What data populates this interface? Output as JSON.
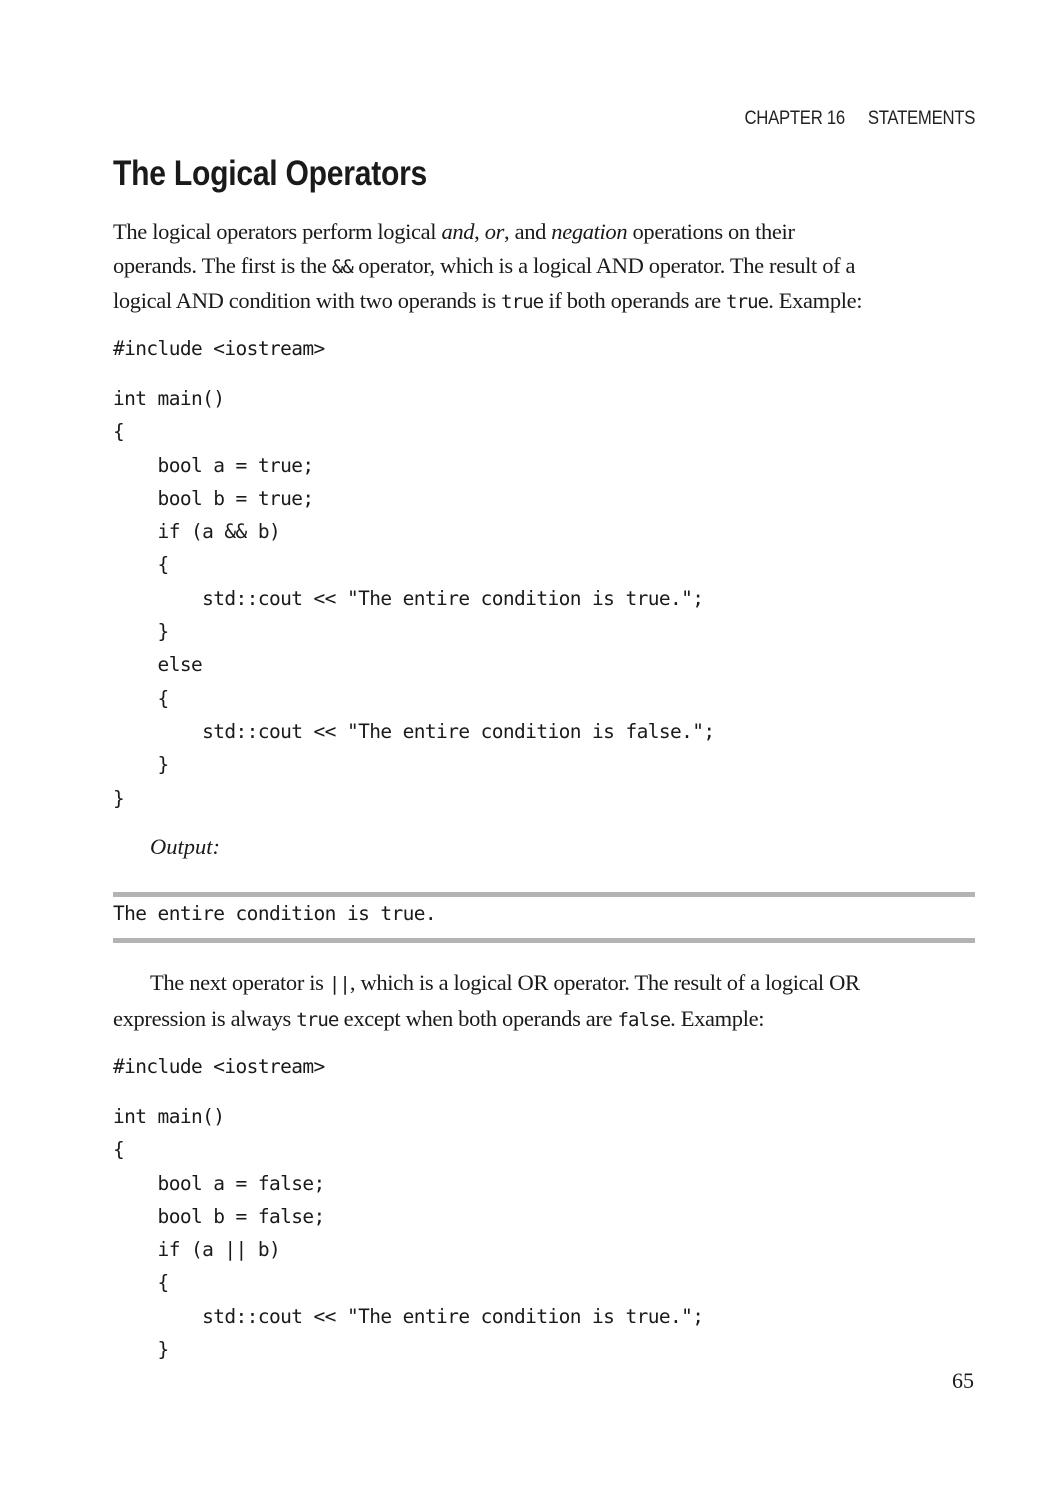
{
  "running_head": {
    "chapter": "CHAPTER 16",
    "section": "STATEMENTS"
  },
  "heading": "The Logical Operators",
  "para1": {
    "l1_a": "The logical operators perform logical ",
    "l1_and": "and",
    "l1_b": ", ",
    "l1_or": "or",
    "l1_c": ", and ",
    "l1_neg": "negation",
    "l1_d": " operations on their",
    "l2_a": "operands. The first is the ",
    "l2_op": "&&",
    "l2_b": " operator, which is a logical AND operator. The result of a",
    "l3_a": "logical AND condition with two operands is ",
    "l3_true1": "true",
    "l3_b": " if both operands are ",
    "l3_true2": "true",
    "l3_c": ". Example:"
  },
  "code1": {
    "include": "#include <iostream>",
    "body": "int main()\n{\n    bool a = true;\n    bool b = true;\n    if (a && b)\n    {\n        std::cout << \"The entire condition is true.\";\n    }\n    else\n    {\n        std::cout << \"The entire condition is false.\";\n    }\n}"
  },
  "output_label": "Output:",
  "output_text": "The entire condition is true.",
  "para2": {
    "l1_a": "The next operator is ",
    "l1_op": "||",
    "l1_b": ", which is a logical OR operator. The result of a logical OR",
    "l2_a": "expression is always ",
    "l2_true": "true",
    "l2_b": " except when both operands are ",
    "l2_false": "false",
    "l2_c": ". Example:"
  },
  "code2": {
    "include": "#include <iostream>",
    "body": "int main()\n{\n    bool a = false;\n    bool b = false;\n    if (a || b)\n    {\n        std::cout << \"The entire condition is true.\";\n    }"
  },
  "page_number": "65"
}
